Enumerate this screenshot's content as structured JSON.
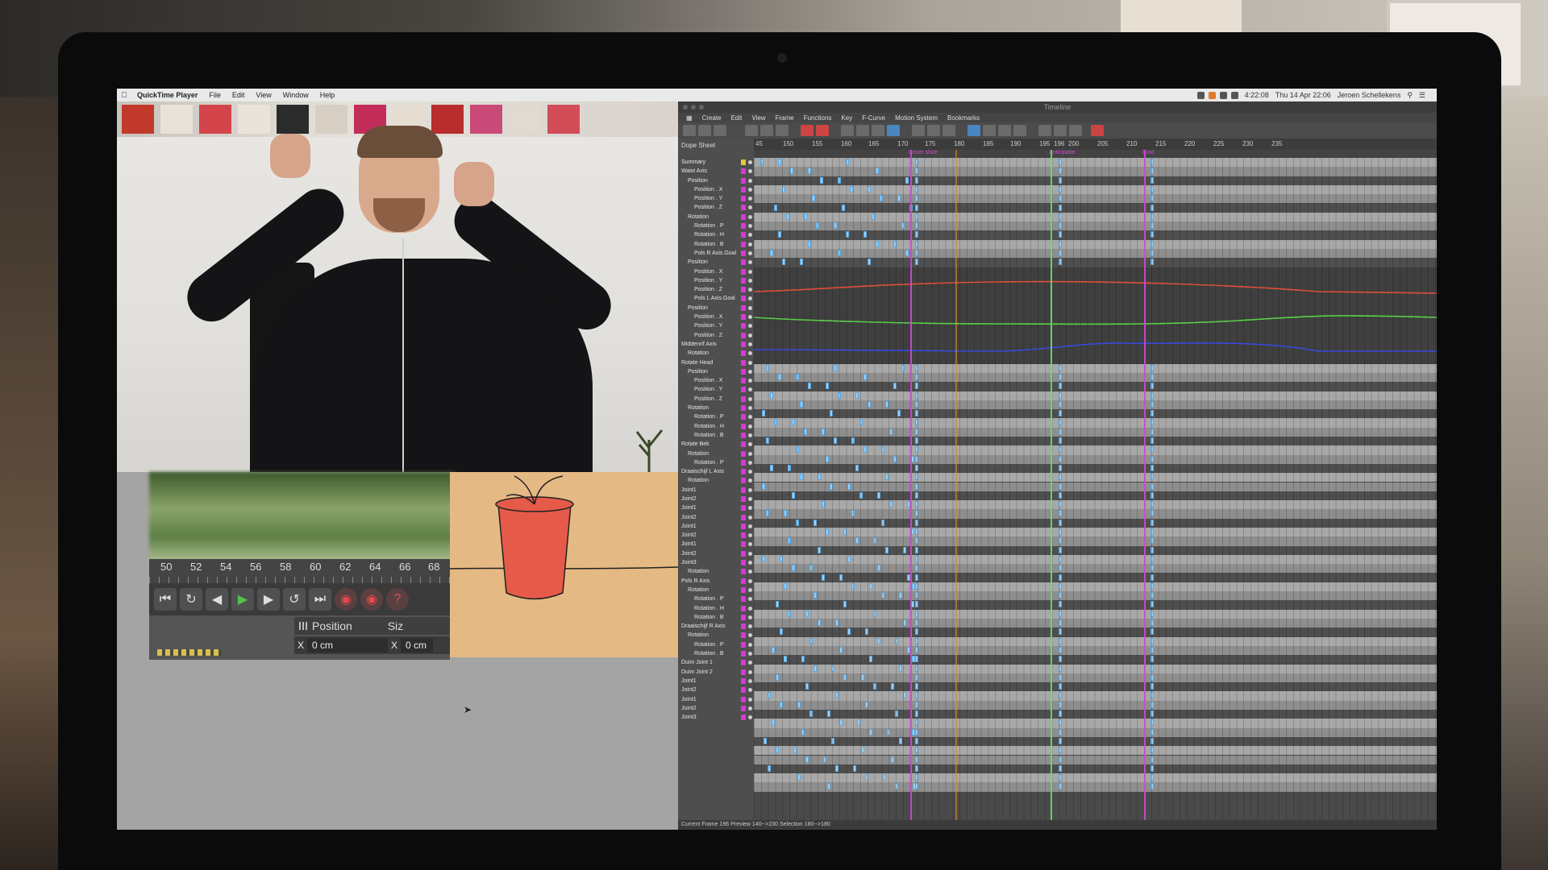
{
  "menubar": {
    "app": "QuickTime Player",
    "items": [
      "File",
      "Edit",
      "View",
      "Window",
      "Help"
    ],
    "clock": "Thu 14 Apr 22:06",
    "user": "Jeroen Schellekens",
    "battery": "4:22:08"
  },
  "qt_panel": {
    "ruler_ticks": [
      "50",
      "52",
      "54",
      "56",
      "58",
      "60",
      "62",
      "64",
      "66",
      "68"
    ],
    "attr_header": "Position",
    "attr_header_2": "Siz",
    "attr_x_label": "X",
    "attr_x_value": "0 cm",
    "attr_x2_label": "X",
    "attr_x2_value": "0 cm"
  },
  "timeline": {
    "title": "Timeline",
    "menu": [
      "Create",
      "Edit",
      "View",
      "Frame",
      "Functions",
      "Key",
      "F-Curve",
      "Motion System",
      "Bookmarks"
    ],
    "panel_title": "Dope Sheet",
    "frames": [
      "45",
      "150",
      "155",
      "160",
      "165",
      "170",
      "175",
      "180",
      "185",
      "190",
      "195",
      "196",
      "200",
      "205",
      "210",
      "215",
      "220",
      "225",
      "230",
      "235"
    ],
    "markers": [
      "Cover shoe",
      "Anticipatie",
      "Eind"
    ],
    "tracks": [
      "Summary",
      "Waist Axis",
      "Position",
      "Position . X",
      "Position . Y",
      "Position . Z",
      "Rotation",
      "Rotation . P",
      "Rotation . H",
      "Rotation . B",
      "Pols R Axis.Goal",
      "Position",
      "Position . X",
      "Position . Y",
      "Position . Z",
      "Pols L Axis.Goal",
      "Position",
      "Position . X",
      "Position . Y",
      "Position . Z",
      "Middenrif Axis",
      "Rotation",
      "Rotate Head",
      "Position",
      "Position . X",
      "Position . Y",
      "Position . Z",
      "Rotation",
      "Rotation . P",
      "Rotation . H",
      "Rotation . B",
      "Rotate Bek",
      "Rotation",
      "Rotation . P",
      "Draaischijf L Axis",
      "Rotation",
      "Joint1",
      "Joint2",
      "Joint1",
      "Joint2",
      "Joint1",
      "Joint2",
      "Joint1",
      "Joint2",
      "Joint3",
      "Rotation",
      "Pols R Axis",
      "Rotation",
      "Rotation . P",
      "Rotation . H",
      "Rotation . B",
      "Draaischijf R Axis",
      "Rotation",
      "Rotation . P",
      "Rotation . B",
      "Duim Joint 1",
      "Duim Joint 2",
      "Joint1",
      "Joint2",
      "Joint1",
      "Joint2",
      "Joint3"
    ],
    "status": "Current Frame  196  Preview  140-->230     Selection  180-->180"
  },
  "colors": {
    "key_blue": "#9ecff3",
    "marker_magenta": "#d04ad0",
    "curve_red": "#e0503a",
    "curve_green": "#5bd24a",
    "curve_blue": "#3a4ae0",
    "playhead_green": "#6ae06a"
  }
}
